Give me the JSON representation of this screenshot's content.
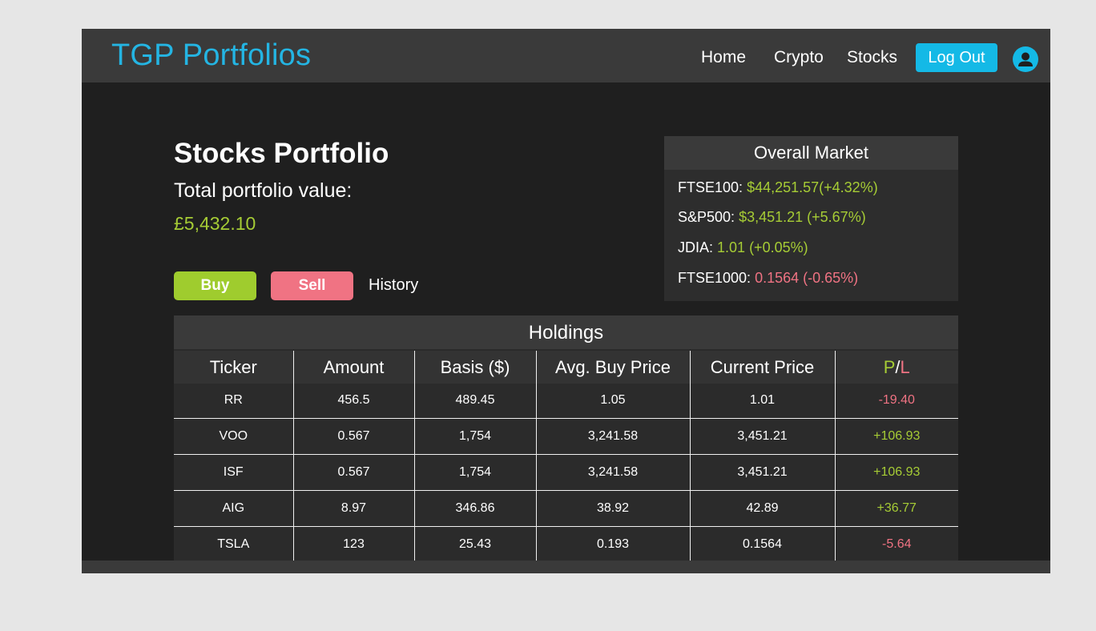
{
  "app": {
    "brand": "TGP Portfolios",
    "nav": {
      "home": "Home",
      "crypto": "Crypto",
      "stocks": "Stocks",
      "logout": "Log Out"
    }
  },
  "portfolio": {
    "title": "Stocks Portfolio",
    "value_label": "Total portfolio value:",
    "value": "£5,432.10",
    "buy_label": "Buy",
    "sell_label": "Sell",
    "history_label": "History"
  },
  "market": {
    "title": "Overall Market",
    "rows": [
      {
        "name": "FTSE100:",
        "value": "$44,251.57(+4.32%)",
        "trend": "up"
      },
      {
        "name": "S&P500:",
        "value": "$3,451.21 (+5.67%)",
        "trend": "up"
      },
      {
        "name": "JDIA:",
        "value": "1.01 (+0.05%)",
        "trend": "up"
      },
      {
        "name": "FTSE1000:",
        "value": "0.1564 (-0.65%)",
        "trend": "down"
      }
    ]
  },
  "holdings": {
    "title": "Holdings",
    "columns": [
      "Ticker",
      "Amount",
      "Basis ($)",
      "Avg. Buy Price",
      "Current Price"
    ],
    "pl_header": {
      "p": "P",
      "slash": "/",
      "l": "L"
    },
    "rows": [
      {
        "ticker": "RR",
        "amount": "456.5",
        "basis": "489.45",
        "avg": "1.05",
        "current": "1.01",
        "pl": "-19.40",
        "trend": "down"
      },
      {
        "ticker": "VOO",
        "amount": "0.567",
        "basis": "1,754",
        "avg": "3,241.58",
        "current": "3,451.21",
        "pl": "+106.93",
        "trend": "up"
      },
      {
        "ticker": "ISF",
        "amount": "0.567",
        "basis": "1,754",
        "avg": "3,241.58",
        "current": "3,451.21",
        "pl": "+106.93",
        "trend": "up"
      },
      {
        "ticker": "AIG",
        "amount": "8.97",
        "basis": "346.86",
        "avg": "38.92",
        "current": "42.89",
        "pl": "+36.77",
        "trend": "up"
      },
      {
        "ticker": "TSLA",
        "amount": "123",
        "basis": "25.43",
        "avg": "0.193",
        "current": "0.1564",
        "pl": "-5.64",
        "trend": "down"
      }
    ]
  },
  "colors": {
    "accent": "#14b9e6",
    "up": "#a6cc35",
    "down": "#f07383",
    "panel": "#2d2d2d",
    "background": "#1f1f1f"
  }
}
